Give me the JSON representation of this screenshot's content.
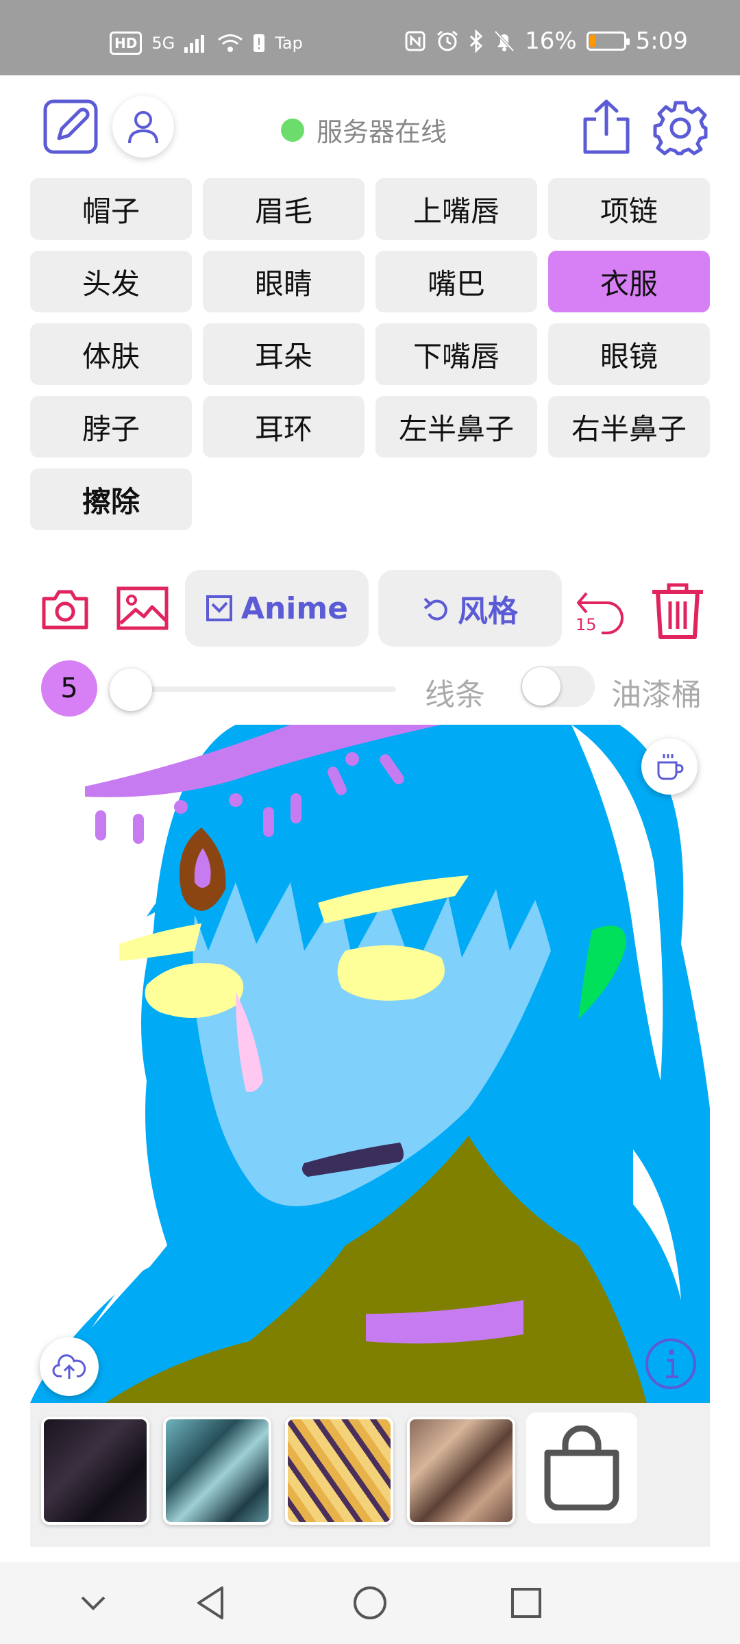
{
  "status_bar": {
    "hd": "HD",
    "network": "5G",
    "tap": "Tap",
    "battery_text": "16%",
    "battery_level": 0.16,
    "time": "5:09",
    "icons": [
      "nfc-icon",
      "alarm-icon",
      "bluetooth-icon",
      "mute-icon"
    ]
  },
  "header": {
    "server_status": "服务器在线",
    "status_color": "#6cdd6c"
  },
  "parts": [
    {
      "label": "帽子"
    },
    {
      "label": "眉毛"
    },
    {
      "label": "上嘴唇"
    },
    {
      "label": "项链"
    },
    {
      "label": "头发"
    },
    {
      "label": "眼睛"
    },
    {
      "label": "嘴巴"
    },
    {
      "label": "衣服",
      "active": true
    },
    {
      "label": "体肤"
    },
    {
      "label": "耳朵"
    },
    {
      "label": "下嘴唇"
    },
    {
      "label": "眼镜"
    },
    {
      "label": "脖子"
    },
    {
      "label": "耳环"
    },
    {
      "label": "左半鼻子"
    },
    {
      "label": "右半鼻子"
    },
    {
      "label": "擦除"
    }
  ],
  "toolbar": {
    "model_label": "Anime",
    "style_label": "风格",
    "undo_count": "15"
  },
  "brush": {
    "size": "5",
    "slider_value": 0,
    "line_label": "线条",
    "bucket_label": "油漆桶",
    "bucket_enabled": false
  },
  "colors": {
    "accent": "#d77ff5",
    "icon_red": "#e0245e",
    "icon_blue": "#5b5bd6",
    "hair": "#00aaf5",
    "skin": "#7fd0fb",
    "clothes": "#808000",
    "eyes": "#ffff99"
  }
}
